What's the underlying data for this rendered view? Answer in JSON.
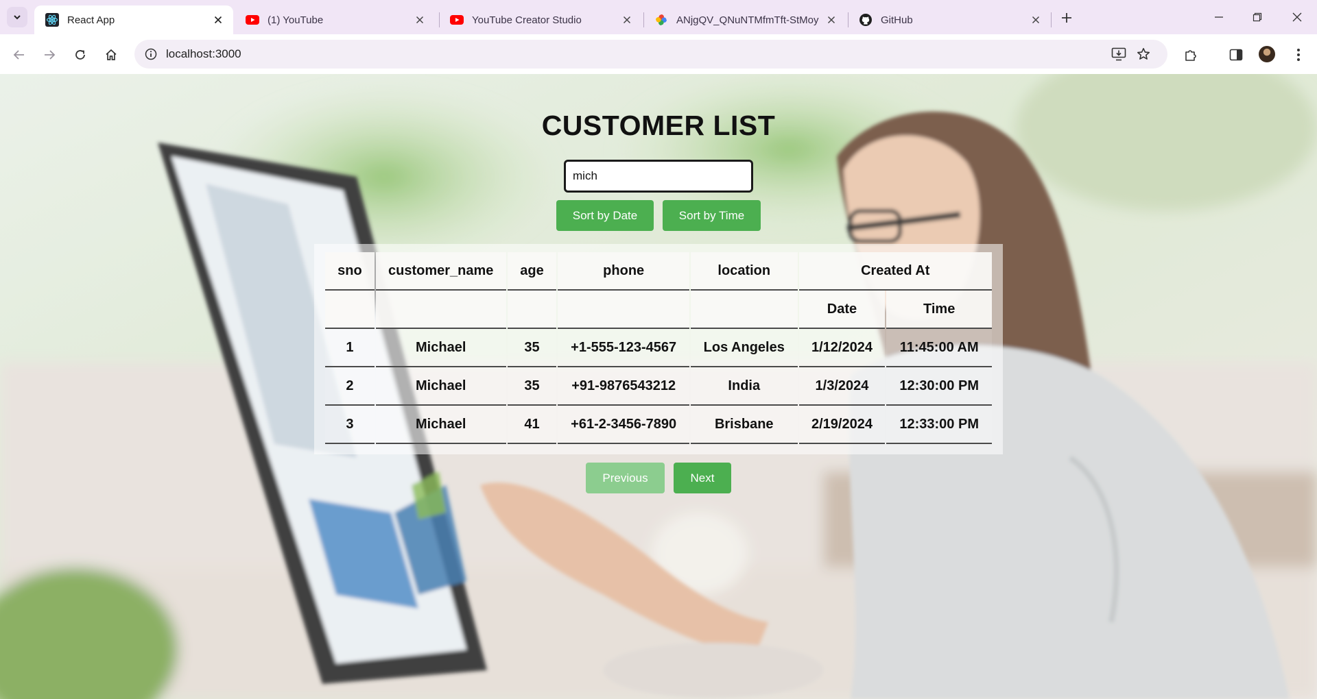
{
  "browser": {
    "tabs": [
      {
        "title": "React App",
        "icon": "react-icon",
        "active": true
      },
      {
        "title": "(1) YouTube",
        "icon": "youtube-icon",
        "active": false
      },
      {
        "title": "YouTube Creator Studio",
        "icon": "youtube-icon",
        "active": false
      },
      {
        "title": "ANjgQV_QNuNTMfmTft-StMoy",
        "icon": "google-photos-icon",
        "active": false
      },
      {
        "title": "GitHub",
        "icon": "github-icon",
        "active": false
      }
    ],
    "url": "localhost:3000"
  },
  "page": {
    "title": "CUSTOMER LIST",
    "search": {
      "value": "mich",
      "placeholder": ""
    },
    "sort_buttons": {
      "date": "Sort by Date",
      "time": "Sort by Time"
    },
    "table": {
      "headers": [
        "sno",
        "customer_name",
        "age",
        "phone",
        "location"
      ],
      "created_at": {
        "label": "Created At",
        "date": "Date",
        "time": "Time"
      },
      "rows": [
        {
          "sno": "1",
          "customer_name": "Michael",
          "age": "35",
          "phone": "+1-555-123-4567",
          "location": "Los Angeles",
          "date": "1/12/2024",
          "time": "11:45:00 AM"
        },
        {
          "sno": "2",
          "customer_name": "Michael",
          "age": "35",
          "phone": "+91-9876543212",
          "location": "India",
          "date": "1/3/2024",
          "time": "12:30:00 PM"
        },
        {
          "sno": "3",
          "customer_name": "Michael",
          "age": "41",
          "phone": "+61-2-3456-7890",
          "location": "Brisbane",
          "date": "2/19/2024",
          "time": "12:33:00 PM"
        }
      ]
    },
    "pagination": {
      "previous": "Previous",
      "next": "Next"
    }
  },
  "colors": {
    "accent": "#4caf50",
    "accent_disabled": "#8ccd8f"
  }
}
